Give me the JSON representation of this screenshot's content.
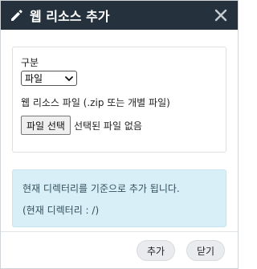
{
  "dialog": {
    "title": "웹 리소스 추가",
    "icons": {
      "title": "pencil-icon",
      "close": "close-icon"
    }
  },
  "form": {
    "category_label": "구분",
    "category_selected": "파일",
    "file_label": "웹 리소스 파일 (.zip 또는 개별 파일)",
    "file_button": "파일 선택",
    "file_status": "선택된 파일 없음"
  },
  "info": {
    "line1": "현재 디렉터리를 기준으로 추가 됩니다.",
    "line2": "(현재 디렉터리 : /)"
  },
  "footer": {
    "add_label": "추가",
    "close_label": "닫기"
  },
  "colors": {
    "header_bg": "#25323d",
    "info_bg": "#d9eff7"
  }
}
